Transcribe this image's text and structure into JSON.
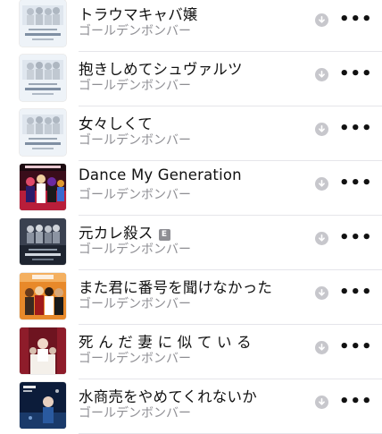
{
  "songs": [
    {
      "title": "トラウマキャバ嬢",
      "artist": "ゴールデンボンバー",
      "explicit": false,
      "art": "best-pressure"
    },
    {
      "title": "抱きしめてシュヴァルツ",
      "artist": "ゴールデンボンバー",
      "explicit": false,
      "art": "best-pressure"
    },
    {
      "title": "女々しくて",
      "artist": "ゴールデンボンバー",
      "explicit": false,
      "art": "best-pressure"
    },
    {
      "title": "Dance My Generation",
      "artist": "ゴールデンボンバー",
      "explicit": false,
      "art": "dance-my-generation"
    },
    {
      "title": "元カレ殺ス",
      "artist": "ゴールデンボンバー",
      "explicit": true,
      "art": "best-dark"
    },
    {
      "title": "また君に番号を聞けなかった",
      "artist": "ゴールデンボンバー",
      "explicit": false,
      "art": "orange-band"
    },
    {
      "title": "死 ん だ 妻 に 似 て い る",
      "artist": "ゴールデンボンバー",
      "explicit": false,
      "art": "red-curtain"
    },
    {
      "title": "水商売をやめてくれないか",
      "artist": "ゴールデンボンバー",
      "explicit": false,
      "art": "blue-night"
    }
  ],
  "explicit_badge": "E",
  "more_label": "•••",
  "icons": {
    "download": "download-arrow-icon",
    "more": "more-ellipsis-icon"
  }
}
